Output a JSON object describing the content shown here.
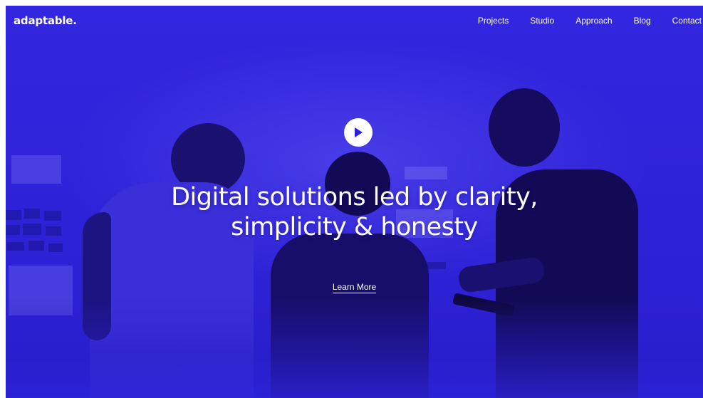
{
  "brand": {
    "logo_text": "adaptable."
  },
  "nav": {
    "items": [
      {
        "label": "Projects"
      },
      {
        "label": "Studio"
      },
      {
        "label": "Approach"
      },
      {
        "label": "Blog"
      },
      {
        "label": "Contact"
      }
    ]
  },
  "hero": {
    "play_icon": "play-icon",
    "headline_line1": "Digital solutions led by clarity,",
    "headline_line2": "simplicity & honesty",
    "cta_label": "Learn More",
    "overlay_color": "#2a1ed6"
  }
}
